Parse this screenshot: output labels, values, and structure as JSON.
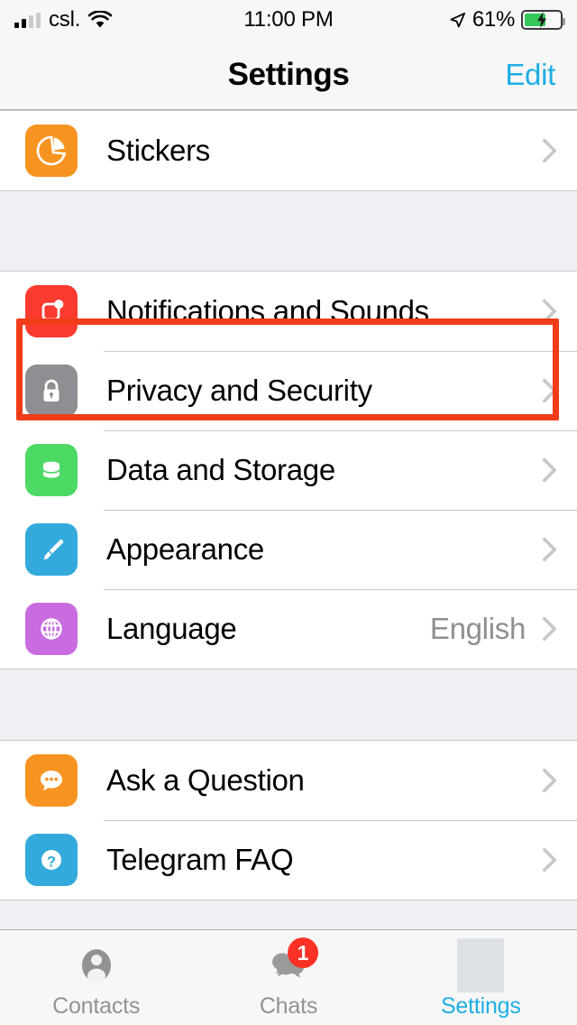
{
  "status_bar": {
    "carrier": "csl.",
    "time": "11:00 PM",
    "battery_percent": "61%",
    "battery_level": 61,
    "charging": true,
    "signal_bars_filled": 2,
    "signal_bars_total": 4,
    "wifi_icon": "wifi-icon",
    "location_icon": "location-arrow-icon",
    "battery_icon": "battery-charging-icon"
  },
  "nav": {
    "title": "Settings",
    "edit_label": "Edit",
    "accent_color": "#1EAEE4"
  },
  "highlight": {
    "color": "#F03C18",
    "target": "Privacy and Security"
  },
  "sections": [
    {
      "rows": [
        {
          "label": "Stickers",
          "icon": "stickers-icon",
          "icon_color": "#F79421",
          "value": "",
          "chevron": true
        }
      ]
    },
    {
      "rows": [
        {
          "label": "Notifications and Sounds",
          "icon": "notifications-icon",
          "icon_color": "#FB3B30",
          "value": "",
          "chevron": true
        },
        {
          "label": "Privacy and Security",
          "icon": "lock-icon",
          "icon_color": "#8E8E93",
          "value": "",
          "chevron": true
        },
        {
          "label": "Data and Storage",
          "icon": "database-icon",
          "icon_color": "#4CD964",
          "value": "",
          "chevron": true
        },
        {
          "label": "Appearance",
          "icon": "paintbrush-icon",
          "icon_color": "#34AADC",
          "value": "",
          "chevron": true
        },
        {
          "label": "Language",
          "icon": "globe-icon",
          "icon_color": "#C86CE0",
          "value": "English",
          "chevron": true
        }
      ]
    },
    {
      "rows": [
        {
          "label": "Ask a Question",
          "icon": "chat-bubble-icon",
          "icon_color": "#F79421",
          "value": "",
          "chevron": true
        },
        {
          "label": "Telegram FAQ",
          "icon": "question-mark-icon",
          "icon_color": "#34AADC",
          "value": "",
          "chevron": true
        }
      ]
    }
  ],
  "tab_bar": {
    "tabs": [
      {
        "label": "Contacts",
        "icon": "person-icon",
        "active": false,
        "badge": ""
      },
      {
        "label": "Chats",
        "icon": "chats-icon",
        "active": false,
        "badge": "1"
      },
      {
        "label": "Settings",
        "icon": "settings-placeholder-icon",
        "active": true,
        "badge": ""
      }
    ]
  }
}
